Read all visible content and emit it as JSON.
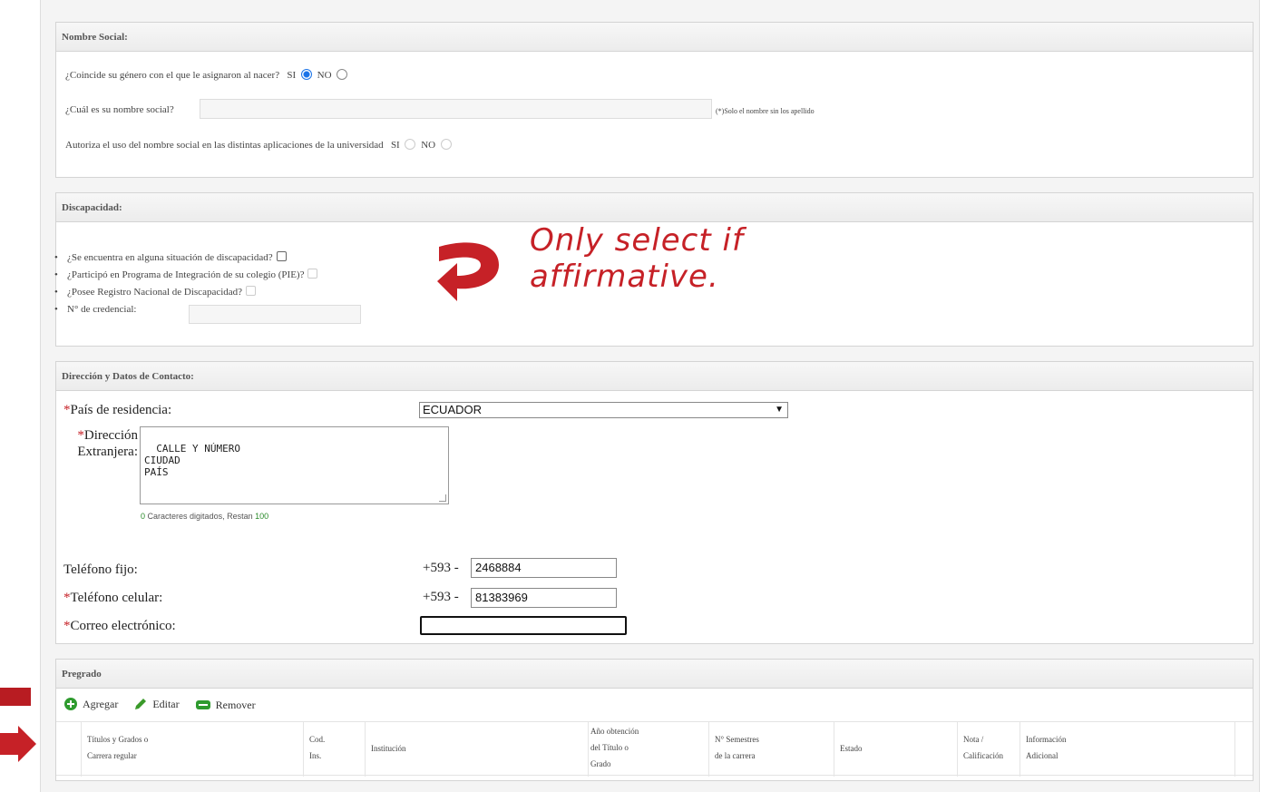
{
  "nombre_social": {
    "header": "Nombre Social:",
    "q1": "¿Coincide su género con el que le asignaron al nacer?",
    "yes": "SI",
    "no": "NO",
    "q2": "¿Cuál es su nombre social?",
    "q2_value": "",
    "q2_note": "(*)Solo el nombre sin los apellido",
    "q3": "Autoriza el uso del nombre social en las distintas aplicaciones de la universidad"
  },
  "discapacidad": {
    "header": "Discapacidad:",
    "items": [
      "¿Se encuentra en alguna situación de discapacidad?",
      "¿Participó en Programa de Integración de su colegio (PIE)?",
      "¿Posee Registro Nacional de Discapacidad?",
      "N° de credencial:"
    ],
    "credencial_value": "",
    "annotation_line1": "Only select if",
    "annotation_line2": "affirmative."
  },
  "contacto": {
    "header": "Dirección y Datos de Contacto:",
    "required_mark": "*",
    "pais_label": "País de residencia:",
    "pais_value": "ECUADOR",
    "direccion_label1": "Dirección",
    "direccion_label2": "Extranjera:",
    "direccion_value": "CALLE Y NÚMERO\nCIUDAD\nPAÍS",
    "counter_typed": "0",
    "counter_text1": "Caracteres digitados, Restan",
    "counter_remaining": "100",
    "tel_fijo_label": "Teléfono fijo:",
    "tel_fijo_prefix": "+593  -",
    "tel_fijo_value": "2468884",
    "tel_cel_label": "Teléfono celular:",
    "tel_cel_prefix": "+593  -",
    "tel_cel_value": "81383969",
    "email_label": "Correo electrónico:",
    "email_value": ""
  },
  "pregrado": {
    "header": "Pregrado",
    "add_label": "Agregar",
    "edit_label": "Editar",
    "remove_label": "Remover",
    "columns": [
      [
        "Títulos y Grados o",
        "Carrera regular"
      ],
      [
        "Cod.",
        "Ins."
      ],
      [
        "Institución"
      ],
      [
        "Año obtención",
        "del Título o",
        "Grado"
      ],
      [
        "N° Semestres",
        "de la carrera"
      ],
      [
        "Estado"
      ],
      [
        "Nota /",
        "Calificación"
      ],
      [
        "Información",
        "Adicional"
      ]
    ]
  },
  "colors": {
    "annotation_red": "#c62127",
    "radio_blue": "#1a73e8",
    "add_green": "#2e9b2e"
  }
}
